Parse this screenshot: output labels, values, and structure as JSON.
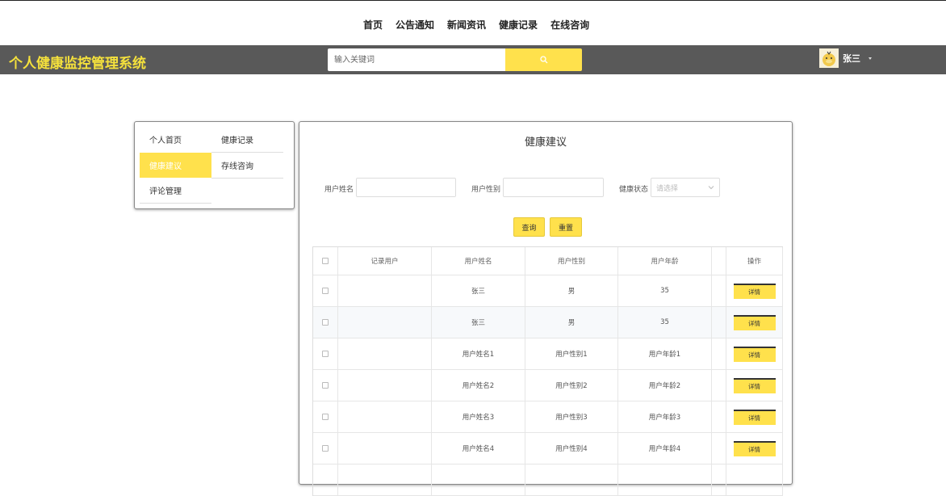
{
  "nav": {
    "items": [
      "首页",
      "公告通知",
      "新闻资讯",
      "健康记录",
      "在线咨询"
    ]
  },
  "header": {
    "logo": "个人健康监控管理系统",
    "search_placeholder": "输入关键词",
    "user_name": "张三"
  },
  "sidebar": {
    "items": [
      "个人首页",
      "健康记录",
      "健康建议",
      "存线咨询",
      "评论管理"
    ],
    "active": "健康建议"
  },
  "main": {
    "title": "健康建议",
    "filters": {
      "name_label": "用户姓名",
      "gender_label": "用户性别",
      "status_label": "健康状态",
      "status_placeholder": "请选择"
    },
    "query_label": "查询",
    "reset_label": "重置",
    "table": {
      "columns": [
        "记录用户",
        "用户姓名",
        "用户性别",
        "用户年龄",
        "操作"
      ],
      "detail_label": "详情",
      "rows": [
        {
          "user": "",
          "name": "张三",
          "gender": "男",
          "age": "35"
        },
        {
          "user": "",
          "name": "张三",
          "gender": "男",
          "age": "35"
        },
        {
          "user": "",
          "name": "用户姓名1",
          "gender": "用户性别1",
          "age": "用户年龄1"
        },
        {
          "user": "",
          "name": "用户姓名2",
          "gender": "用户性别2",
          "age": "用户年龄2"
        },
        {
          "user": "",
          "name": "用户姓名3",
          "gender": "用户性别3",
          "age": "用户年龄3"
        },
        {
          "user": "",
          "name": "用户姓名4",
          "gender": "用户性别4",
          "age": "用户年龄4"
        },
        {
          "user": "",
          "name": "",
          "gender": "",
          "age": ""
        }
      ]
    }
  },
  "colors": {
    "accent": "#ffe14c",
    "header_bg": "#595959",
    "logo": "#f5e13c"
  }
}
